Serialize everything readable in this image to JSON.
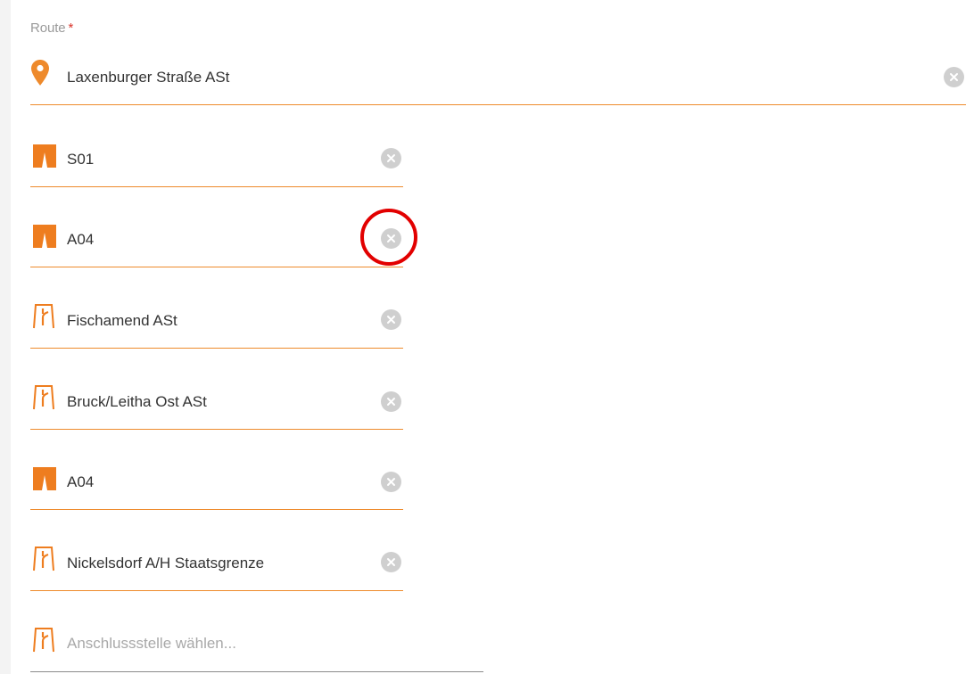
{
  "route": {
    "label": "Route",
    "required_marker": "*",
    "origin": {
      "value": "Laxenburger Straße ASt",
      "icon": "location-pin-icon"
    }
  },
  "segments": [
    {
      "value": "S01",
      "icon": "highway-icon"
    },
    {
      "value": "A04",
      "icon": "highway-icon"
    },
    {
      "value": "Fischamend ASt",
      "icon": "junction-icon"
    },
    {
      "value": "Bruck/Leitha Ost ASt",
      "icon": "junction-icon"
    },
    {
      "value": "A04",
      "icon": "highway-icon"
    },
    {
      "value": "Nickelsdorf A/H Staatsgrenze",
      "icon": "junction-icon"
    }
  ],
  "next_junction": {
    "placeholder": "Anschlussstelle wählen...",
    "icon": "junction-icon"
  },
  "colors": {
    "accent": "#ee8a2c",
    "required": "#d9342b",
    "clear_button": "#cfcfcf",
    "highlight": "#e20000"
  }
}
